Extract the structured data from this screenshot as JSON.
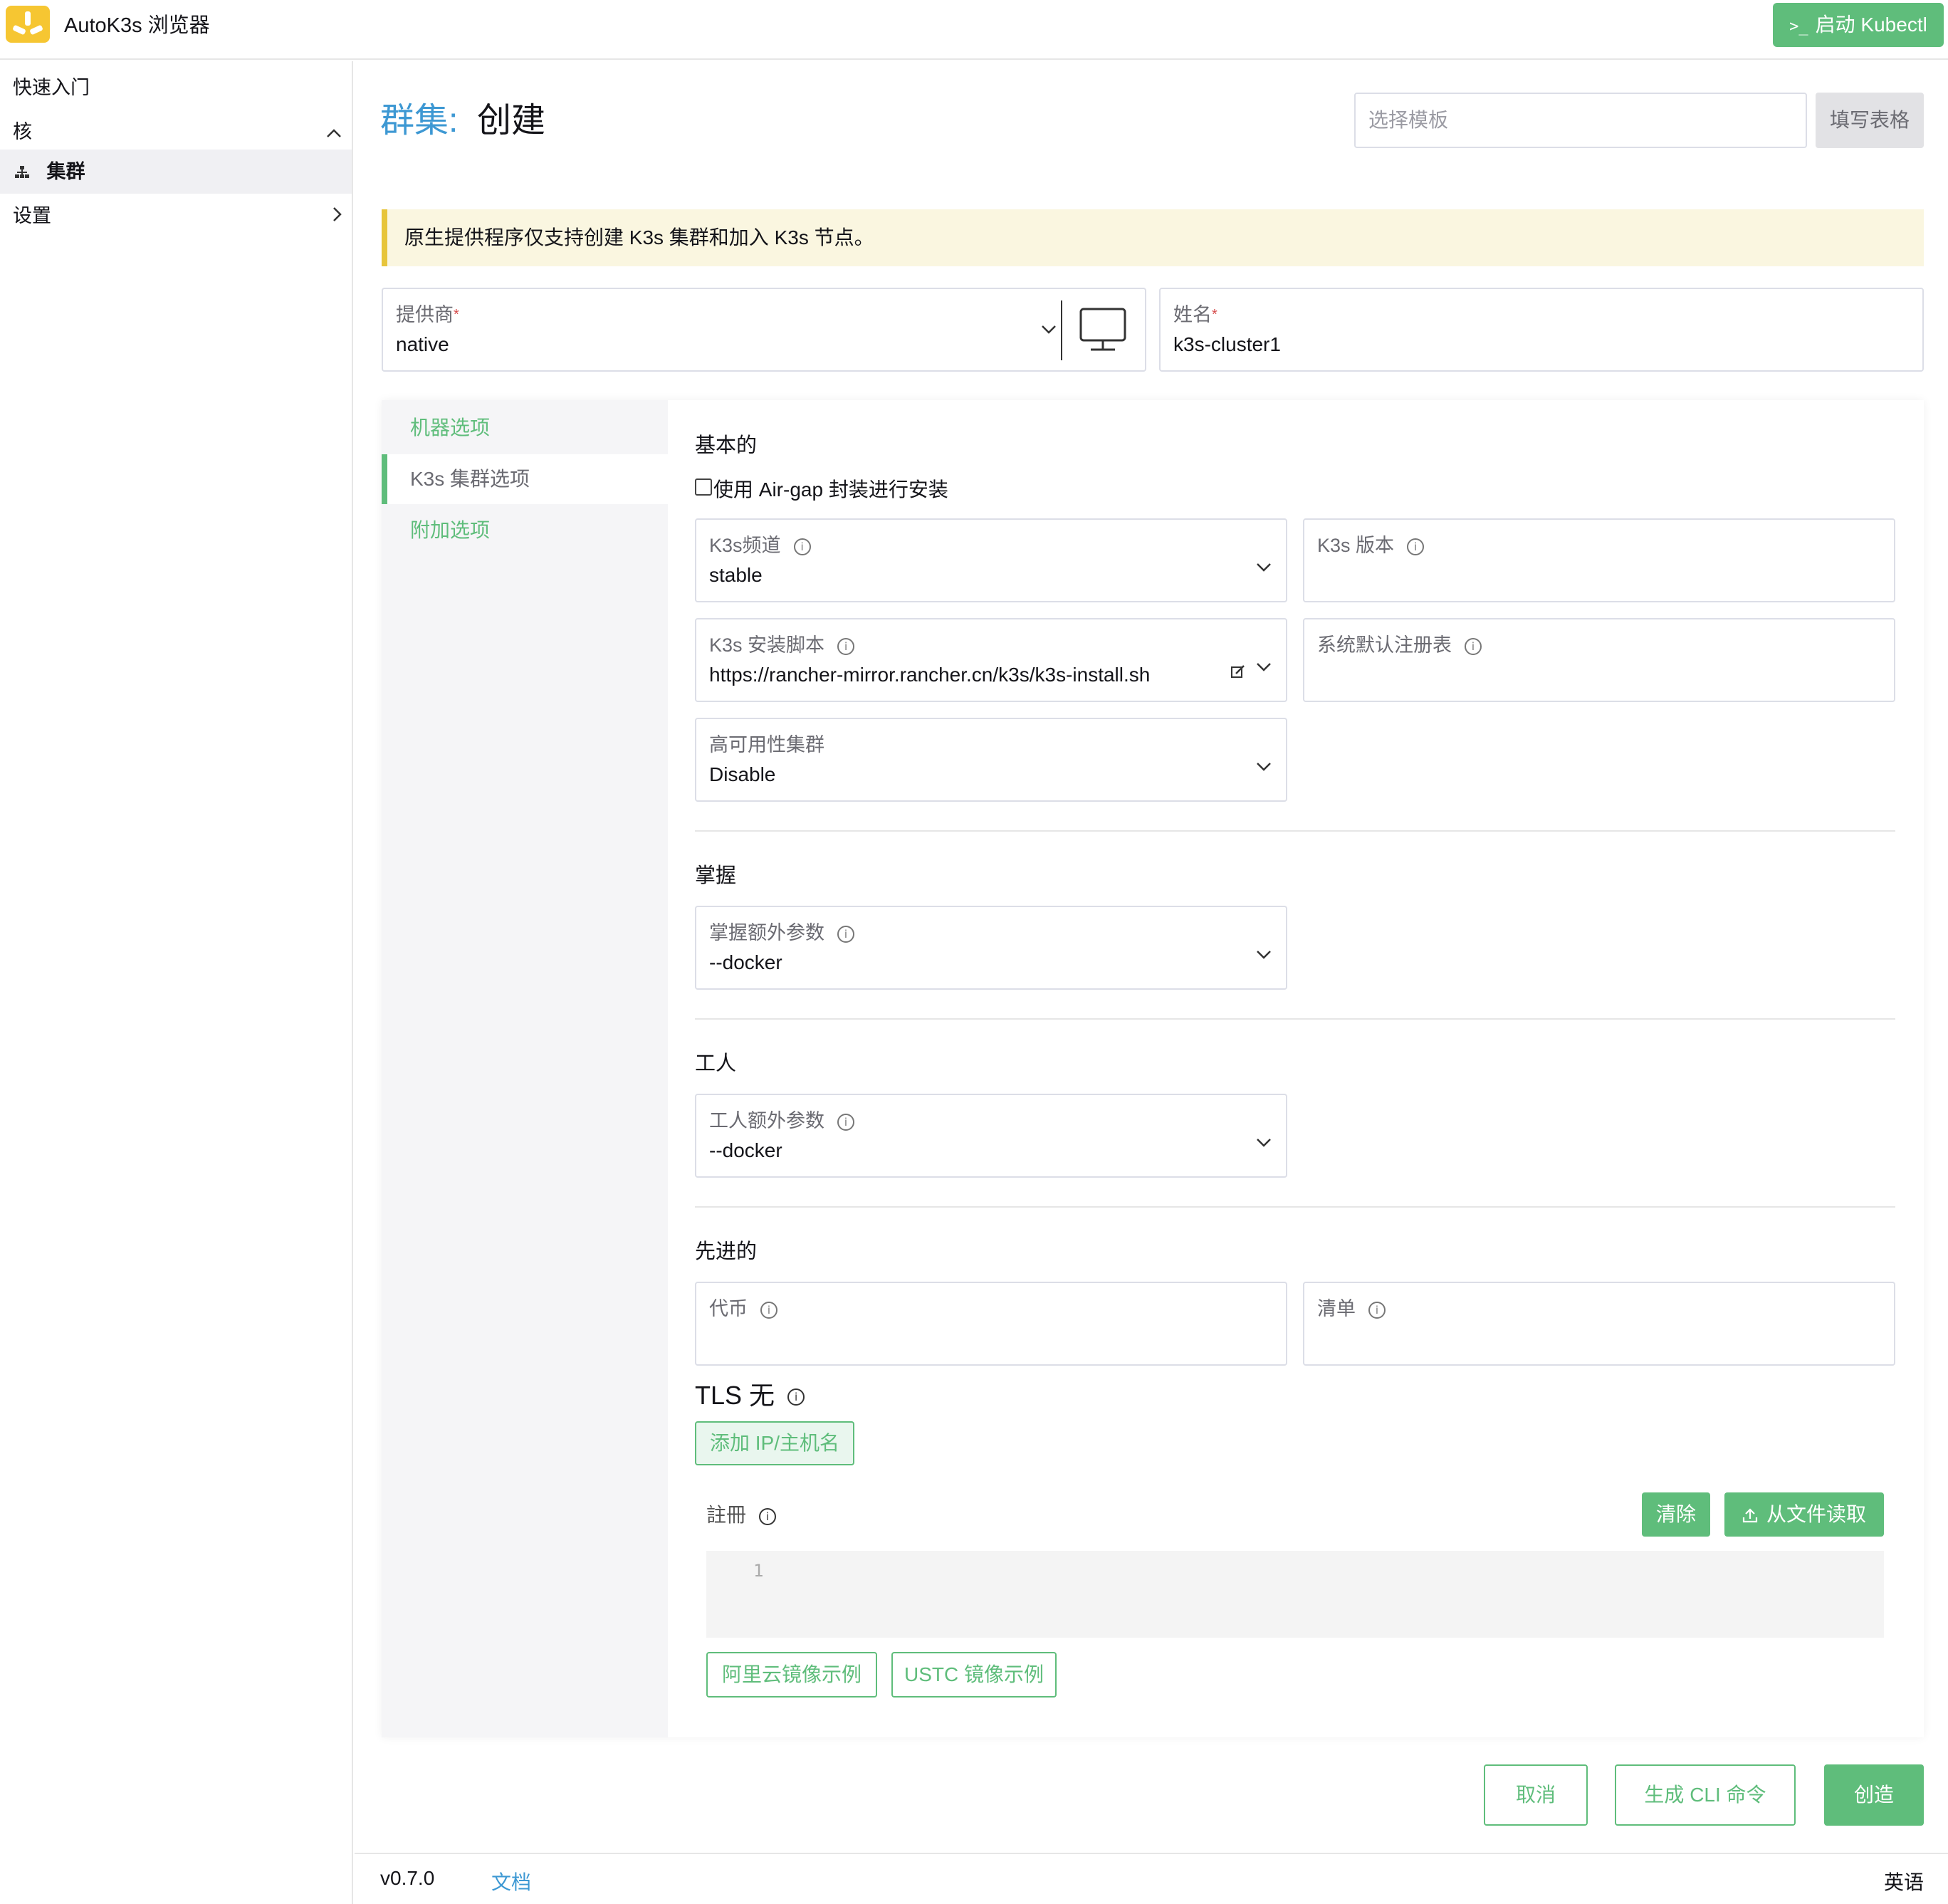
{
  "header": {
    "app_title": "AutoK3s 浏览器",
    "kubectl_label": "启动 Kubectl",
    "kubectl_icon": ">_"
  },
  "sidebar": {
    "quickstart": "快速入门",
    "core": "核",
    "cluster": "集群",
    "settings": "设置"
  },
  "page": {
    "resource": "群集:",
    "action": "创建"
  },
  "template": {
    "placeholder": "选择模板",
    "fill_form": "填写表格"
  },
  "banner": "原生提供程序仅支持创建 K3s 集群和加入 K3s 节点。",
  "provider": {
    "label": "提供商",
    "value": "native"
  },
  "name": {
    "label": "姓名",
    "value": "k3s-cluster1"
  },
  "tabs": [
    "机器选项",
    "K3s 集群选项",
    "附加选项"
  ],
  "basic": {
    "title": "基本的",
    "airgap": "使用 Air-gap 封装进行安装",
    "channel_label": "K3s频道",
    "channel_value": "stable",
    "version_label": "K3s 版本",
    "script_label": "K3s 安装脚本",
    "script_value": "https://rancher-mirror.rancher.cn/k3s/k3s-install.sh",
    "registry_label": "系统默认注册表",
    "ha_label": "高可用性集群",
    "ha_value": "Disable"
  },
  "master": {
    "title": "掌握",
    "args_label": "掌握额外参数",
    "args_value": "--docker"
  },
  "worker": {
    "title": "工人",
    "args_label": "工人额外参数",
    "args_value": "--docker"
  },
  "advanced": {
    "title": "先进的",
    "token_label": "代币",
    "manifest_label": "清单",
    "tls_title": "TLS 无",
    "add_ip": "添加 IP/主机名",
    "registry_title": "註冊",
    "clear": "清除",
    "read_file": "从文件读取",
    "line_number": "1",
    "aliyun_example": "阿里云镜像示例",
    "ustc_example": "USTC 镜像示例"
  },
  "actions": {
    "cancel": "取消",
    "cli": "生成 CLI 命令",
    "create": "创造"
  },
  "footer": {
    "version": "v0.7.0",
    "docs": "文档",
    "language": "英语"
  },
  "colors": {
    "accent": "#5fbd7b",
    "link": "#3d98d3",
    "banner_border": "#e7c53b"
  }
}
